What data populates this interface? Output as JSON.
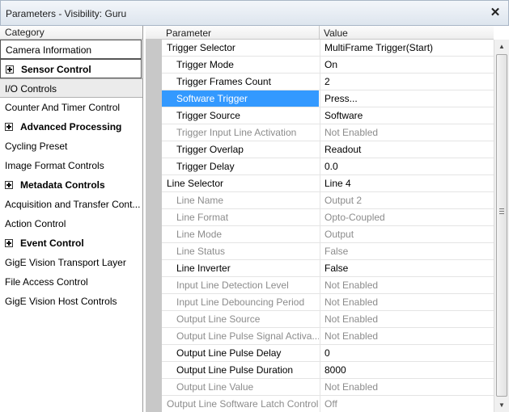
{
  "window": {
    "title": "Parameters - Visibility: Guru",
    "close_glyph": "✕"
  },
  "categories": {
    "header": "Category",
    "items": [
      {
        "label": "Camera Information",
        "bold": false,
        "expandable": false
      },
      {
        "label": "Sensor Control",
        "bold": true,
        "expandable": true
      },
      {
        "label": "I/O Controls",
        "bold": false,
        "expandable": false,
        "selected": true
      },
      {
        "label": "Counter And Timer Control",
        "bold": false,
        "expandable": false
      },
      {
        "label": "Advanced Processing",
        "bold": true,
        "expandable": true
      },
      {
        "label": "Cycling Preset",
        "bold": false,
        "expandable": false
      },
      {
        "label": "Image Format Controls",
        "bold": false,
        "expandable": false
      },
      {
        "label": "Metadata Controls",
        "bold": true,
        "expandable": true
      },
      {
        "label": "Acquisition and Transfer Cont...",
        "bold": false,
        "expandable": false
      },
      {
        "label": "Action Control",
        "bold": false,
        "expandable": false
      },
      {
        "label": "Event Control",
        "bold": true,
        "expandable": true
      },
      {
        "label": "GigE Vision Transport Layer",
        "bold": false,
        "expandable": false
      },
      {
        "label": "File Access Control",
        "bold": false,
        "expandable": false
      },
      {
        "label": "GigE Vision Host Controls",
        "bold": false,
        "expandable": false
      }
    ]
  },
  "grid": {
    "parameter_header": "Parameter",
    "value_header": "Value",
    "rows": [
      {
        "param": "Trigger Selector",
        "value": "MultiFrame Trigger(Start)",
        "indent": 0,
        "enabled": true
      },
      {
        "param": "Trigger Mode",
        "value": "On",
        "indent": 1,
        "enabled": true
      },
      {
        "param": "Trigger Frames Count",
        "value": "2",
        "indent": 1,
        "enabled": true
      },
      {
        "param": "Software Trigger",
        "value": "Press...",
        "indent": 1,
        "enabled": true,
        "selected": true
      },
      {
        "param": "Trigger Source",
        "value": "Software",
        "indent": 1,
        "enabled": true
      },
      {
        "param": "Trigger Input Line Activation",
        "value": "Not Enabled",
        "indent": 1,
        "enabled": false
      },
      {
        "param": "Trigger Overlap",
        "value": "Readout",
        "indent": 1,
        "enabled": true
      },
      {
        "param": "Trigger Delay",
        "value": "0.0",
        "indent": 1,
        "enabled": true
      },
      {
        "param": "Line Selector",
        "value": "Line 4",
        "indent": 0,
        "enabled": true
      },
      {
        "param": "Line Name",
        "value": "Output 2",
        "indent": 1,
        "enabled": false
      },
      {
        "param": "Line Format",
        "value": "Opto-Coupled",
        "indent": 1,
        "enabled": false
      },
      {
        "param": "Line Mode",
        "value": "Output",
        "indent": 1,
        "enabled": false
      },
      {
        "param": "Line Status",
        "value": "False",
        "indent": 1,
        "enabled": false
      },
      {
        "param": "Line Inverter",
        "value": "False",
        "indent": 1,
        "enabled": true
      },
      {
        "param": "Input Line Detection Level",
        "value": "Not Enabled",
        "indent": 1,
        "enabled": false
      },
      {
        "param": "Input Line Debouncing Period",
        "value": "Not Enabled",
        "indent": 1,
        "enabled": false
      },
      {
        "param": "Output Line Source",
        "value": "Not Enabled",
        "indent": 1,
        "enabled": false
      },
      {
        "param": "Output Line Pulse Signal Activa...",
        "value": "Not Enabled",
        "indent": 1,
        "enabled": false
      },
      {
        "param": "Output Line Pulse Delay",
        "value": "0",
        "indent": 1,
        "enabled": true
      },
      {
        "param": "Output Line Pulse Duration",
        "value": "8000",
        "indent": 1,
        "enabled": true
      },
      {
        "param": "Output Line Value",
        "value": "Not Enabled",
        "indent": 1,
        "enabled": false
      },
      {
        "param": "Output Line Software Latch Control",
        "value": "Off",
        "indent": 0,
        "enabled": false
      }
    ]
  },
  "scrollbar": {
    "up_glyph": "▲",
    "down_glyph": "▼"
  }
}
